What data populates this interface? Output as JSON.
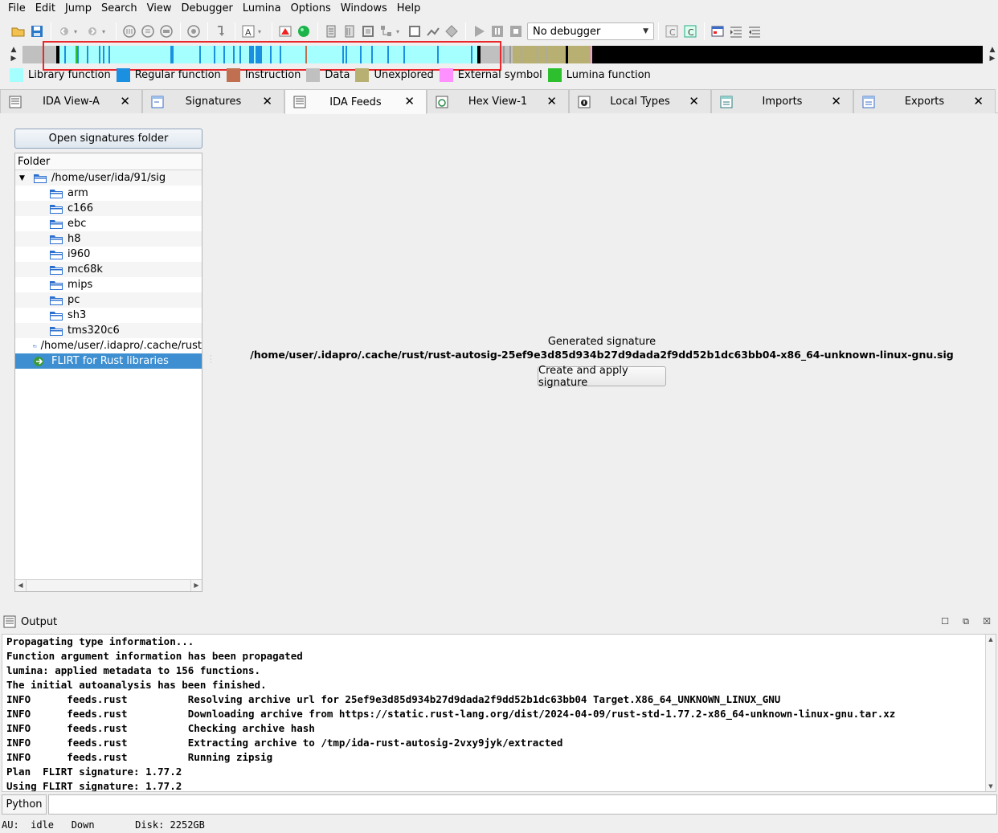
{
  "menu": [
    "File",
    "Edit",
    "Jump",
    "Search",
    "View",
    "Debugger",
    "Lumina",
    "Options",
    "Windows",
    "Help"
  ],
  "toolbar": {
    "debugger_value": "No debugger"
  },
  "legend": [
    {
      "label": "Library function",
      "color": "#a6ffff"
    },
    {
      "label": "Regular function",
      "color": "#1c90e0"
    },
    {
      "label": "Instruction",
      "color": "#c07050"
    },
    {
      "label": "Data",
      "color": "#c0c0c0"
    },
    {
      "label": "Unexplored",
      "color": "#b8b072"
    },
    {
      "label": "External symbol",
      "color": "#ff90ff"
    },
    {
      "label": "Lumina function",
      "color": "#2ebf2e"
    }
  ],
  "tabs": [
    {
      "label": "IDA View-A",
      "active": false
    },
    {
      "label": "Signatures",
      "active": false
    },
    {
      "label": "IDA Feeds",
      "active": true
    },
    {
      "label": "Hex View-1",
      "active": false
    },
    {
      "label": "Local Types",
      "active": false
    },
    {
      "label": "Imports",
      "active": false
    },
    {
      "label": "Exports",
      "active": false
    }
  ],
  "feeds": {
    "open_button": "Open signatures folder",
    "tree_header": "Folder",
    "tree": [
      {
        "label": "/home/user/ida/91/sig",
        "level": 0,
        "expanded": true,
        "kind": "folder"
      },
      {
        "label": "arm",
        "level": 1,
        "kind": "folder"
      },
      {
        "label": "c166",
        "level": 1,
        "kind": "folder"
      },
      {
        "label": "ebc",
        "level": 1,
        "kind": "folder"
      },
      {
        "label": "h8",
        "level": 1,
        "kind": "folder"
      },
      {
        "label": "i960",
        "level": 1,
        "kind": "folder"
      },
      {
        "label": "mc68k",
        "level": 1,
        "kind": "folder"
      },
      {
        "label": "mips",
        "level": 1,
        "kind": "folder"
      },
      {
        "label": "pc",
        "level": 1,
        "kind": "folder"
      },
      {
        "label": "sh3",
        "level": 1,
        "kind": "folder"
      },
      {
        "label": "tms320c6",
        "level": 1,
        "kind": "folder"
      },
      {
        "label": "/home/user/.idapro/.cache/rust",
        "level": 0,
        "kind": "folder"
      },
      {
        "label": "FLIRT for Rust libraries",
        "level": 0,
        "kind": "action",
        "selected": true
      }
    ],
    "generated_label": "Generated signature",
    "generated_path": "/home/user/.idapro/.cache/rust/rust-autosig-25ef9e3d85d934b27d9dada2f9dd52b1dc63bb04-x86_64-unknown-linux-gnu.sig",
    "create_button": "Create and apply signature"
  },
  "output": {
    "title": "Output",
    "lines": [
      "Propagating type information...",
      "Function argument information has been propagated",
      "lumina: applied metadata to 156 functions.",
      "The initial autoanalysis has been finished.",
      "INFO      feeds.rust          Resolving archive url for 25ef9e3d85d934b27d9dada2f9dd52b1dc63bb04 Target.X86_64_UNKNOWN_LINUX_GNU",
      "INFO      feeds.rust          Downloading archive from https://static.rust-lang.org/dist/2024-04-09/rust-std-1.77.2-x86_64-unknown-linux-gnu.tar.xz",
      "INFO      feeds.rust          Checking archive hash",
      "INFO      feeds.rust          Extracting archive to /tmp/ida-rust-autosig-2vxy9jyk/extracted",
      "INFO      feeds.rust          Running zipsig",
      "Plan  FLIRT signature: 1.77.2",
      "Using FLIRT signature: 1.77.2"
    ]
  },
  "cli": {
    "language": "Python",
    "value": ""
  },
  "status": {
    "text": "AU:  idle   Down       Disk: 2252GB"
  }
}
